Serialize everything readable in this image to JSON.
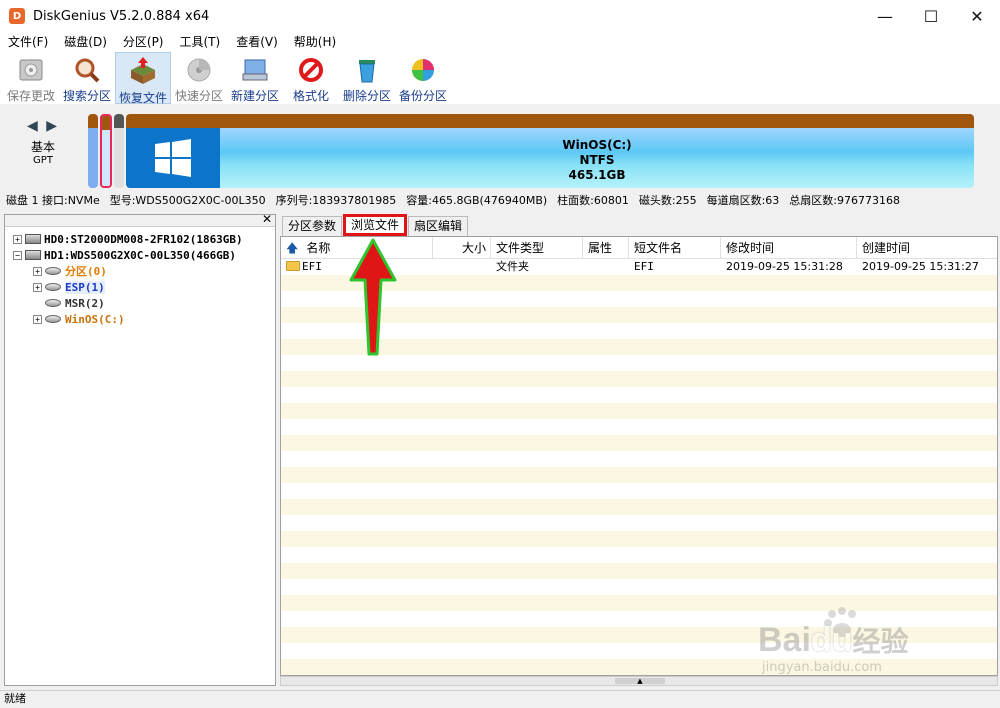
{
  "window": {
    "title": "DiskGenius V5.2.0.884 x64",
    "app_icon_letter": "D",
    "minimize": "—",
    "maximize": "☐",
    "close": "✕"
  },
  "menu": [
    "文件(F)",
    "磁盘(D)",
    "分区(P)",
    "工具(T)",
    "查看(V)",
    "帮助(H)"
  ],
  "toolbar": {
    "save": "保存更改",
    "search": "搜索分区",
    "recover": "恢复文件",
    "quick": "快速分区",
    "new": "新建分区",
    "format": "格式化",
    "delete": "删除分区",
    "backup": "备份分区"
  },
  "disk": {
    "nav_arrows": "◀ ▶",
    "type": "基本",
    "table": "GPT",
    "partition_name": "WinOS(C:)",
    "partition_fs": "NTFS",
    "partition_size": "465.1GB"
  },
  "info": {
    "disk": "磁盘 1 接口:NVMe",
    "model": "型号:WDS500G2X0C-00L350",
    "serial": "序列号:183937801985",
    "capacity": "容量:465.8GB(476940MB)",
    "cylinders": "柱面数:60801",
    "heads": "磁头数:255",
    "sectors_per_track": "每道扇区数:63",
    "total_sectors": "总扇区数:976773168"
  },
  "tree": {
    "close": "✕",
    "hd0": "HD0:ST2000DM008-2FR102(1863GB)",
    "hd1": "HD1:WDS500G2X0C-00L350(466GB)",
    "part0": "分区(0)",
    "esp": "ESP(1)",
    "msr": "MSR(2)",
    "winos": "WinOS(C:)",
    "expand": "+",
    "collapse": "−"
  },
  "tabs": {
    "params": "分区参数",
    "browse": "浏览文件",
    "sector": "扇区编辑"
  },
  "table": {
    "up_icon": "🡅",
    "headers": {
      "name": "名称",
      "size": "大小",
      "type": "文件类型",
      "attr": "属性",
      "short": "短文件名",
      "modified": "修改时间",
      "created": "创建时间"
    },
    "rows": [
      {
        "name": "EFI",
        "size": "",
        "type": "文件夹",
        "attr": "",
        "short": "EFI",
        "modified": "2019-09-25 15:31:28",
        "created": "2019-09-25 15:31:27"
      }
    ],
    "scroll_thumb": "▲"
  },
  "status": "就绪",
  "watermark": {
    "brand": "Bai",
    "brand2": "du",
    "cn": "经验",
    "url": "jingyan.baidu.com"
  },
  "colors": {
    "annotation": "#e01616",
    "annotation_outline": "#2ec52e"
  }
}
